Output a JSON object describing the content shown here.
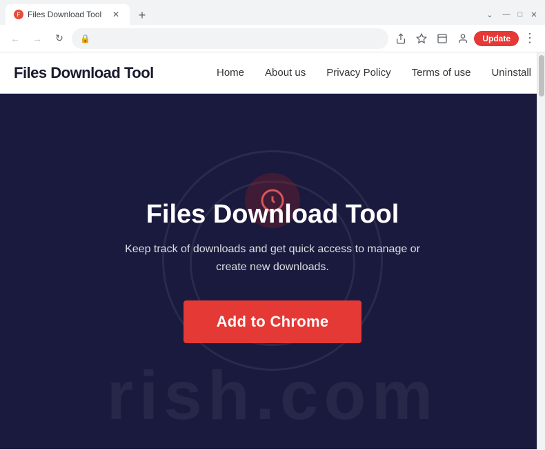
{
  "browser": {
    "tab": {
      "title": "Files Download Tool",
      "favicon_label": "F"
    },
    "new_tab_label": "+",
    "window_controls": {
      "chevron": "⌄",
      "minimize": "—",
      "maximize": "□",
      "close": "✕"
    },
    "address_bar": {
      "url": "",
      "lock_icon": "🔒"
    },
    "update_button_label": "Update",
    "menu_dots": "⋮"
  },
  "nav": {
    "logo": "Files Download Tool",
    "links": [
      {
        "label": "Home"
      },
      {
        "label": "About us"
      },
      {
        "label": "Privacy Policy"
      },
      {
        "label": "Terms of use"
      },
      {
        "label": "Uninstall"
      }
    ]
  },
  "hero": {
    "title": "Files Download Tool",
    "subtitle": "Keep track of downloads and get quick access to manage or create new downloads.",
    "cta_button": "Add to Chrome",
    "watermark": "rish.com"
  }
}
